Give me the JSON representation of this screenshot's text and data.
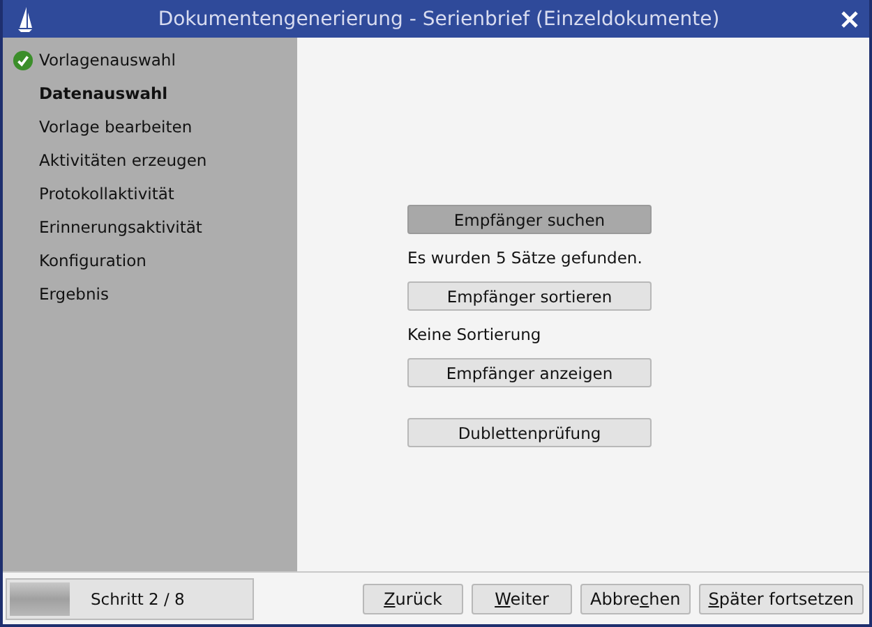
{
  "window": {
    "title": "Dokumentengenerierung - Serienbrief (Einzeldokumente)"
  },
  "steps": [
    {
      "label": "Vorlagenauswahl",
      "done": true,
      "selected": false
    },
    {
      "label": "Datenauswahl",
      "done": false,
      "selected": true
    },
    {
      "label": "Vorlage bearbeiten",
      "done": false,
      "selected": false
    },
    {
      "label": "Aktivitäten erzeugen",
      "done": false,
      "selected": false
    },
    {
      "label": "Protokollaktivität",
      "done": false,
      "selected": false
    },
    {
      "label": "Erinnerungsaktivität",
      "done": false,
      "selected": false
    },
    {
      "label": "Konfiguration",
      "done": false,
      "selected": false
    },
    {
      "label": "Ergebnis",
      "done": false,
      "selected": false
    }
  ],
  "actions": [
    {
      "kind": "button",
      "label": "Empfänger suchen",
      "pressed": true
    },
    {
      "kind": "text",
      "label": "Es wurden 5 Sätze gefunden."
    },
    {
      "kind": "button",
      "label": "Empfänger sortieren",
      "pressed": false
    },
    {
      "kind": "text",
      "label": "Keine Sortierung"
    },
    {
      "kind": "button",
      "label": "Empfänger anzeigen",
      "pressed": false
    },
    {
      "kind": "gap"
    },
    {
      "kind": "button",
      "label": "Dublettenprüfung",
      "pressed": false
    }
  ],
  "progress": {
    "level": 0.25,
    "label": "Schritt 2 / 8"
  },
  "buttons": [
    {
      "key": "Z",
      "post": "urück"
    },
    {
      "key": "W",
      "post": "eiter"
    },
    {
      "pre": "Abbre",
      "key": "c",
      "post": "hen"
    },
    {
      "key": "S",
      "post": "päter fortsetzen"
    }
  ]
}
